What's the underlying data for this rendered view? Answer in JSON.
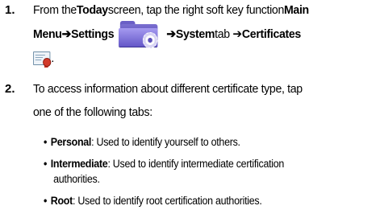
{
  "steps": [
    {
      "number": "1.",
      "t1": "From the ",
      "t2": "Today",
      "t3": " screen, tap the right soft key function ",
      "t4": "Main",
      "t5": "Menu",
      "t6": " ➔ ",
      "t7": "Settings",
      "t8": " ➔ ",
      "t9": "System",
      "t10": " tab ➔ ",
      "t11": "Certificates",
      "t12": "."
    },
    {
      "number": "2.",
      "line1": "To access information about different certificate type, tap",
      "line2": "one of the following tabs:"
    }
  ],
  "icons": {
    "settings": "settings-folder-icon",
    "certificates": "certificate-icon"
  },
  "tabs": [
    {
      "bullet": "•",
      "name": "Personal",
      "desc1": ": Used to identify yourself to others.",
      "desc2": ""
    },
    {
      "bullet": "•",
      "name": "Intermediate",
      "desc1": ": Used to identify intermediate certification",
      "desc2": "authorities."
    },
    {
      "bullet": "•",
      "name": "Root",
      "desc1": ": Used to identify root certification authorities.",
      "desc2": ""
    }
  ],
  "colors": {
    "text": "#000000",
    "folder": "#6457c8",
    "seal": "#d23a2a"
  }
}
